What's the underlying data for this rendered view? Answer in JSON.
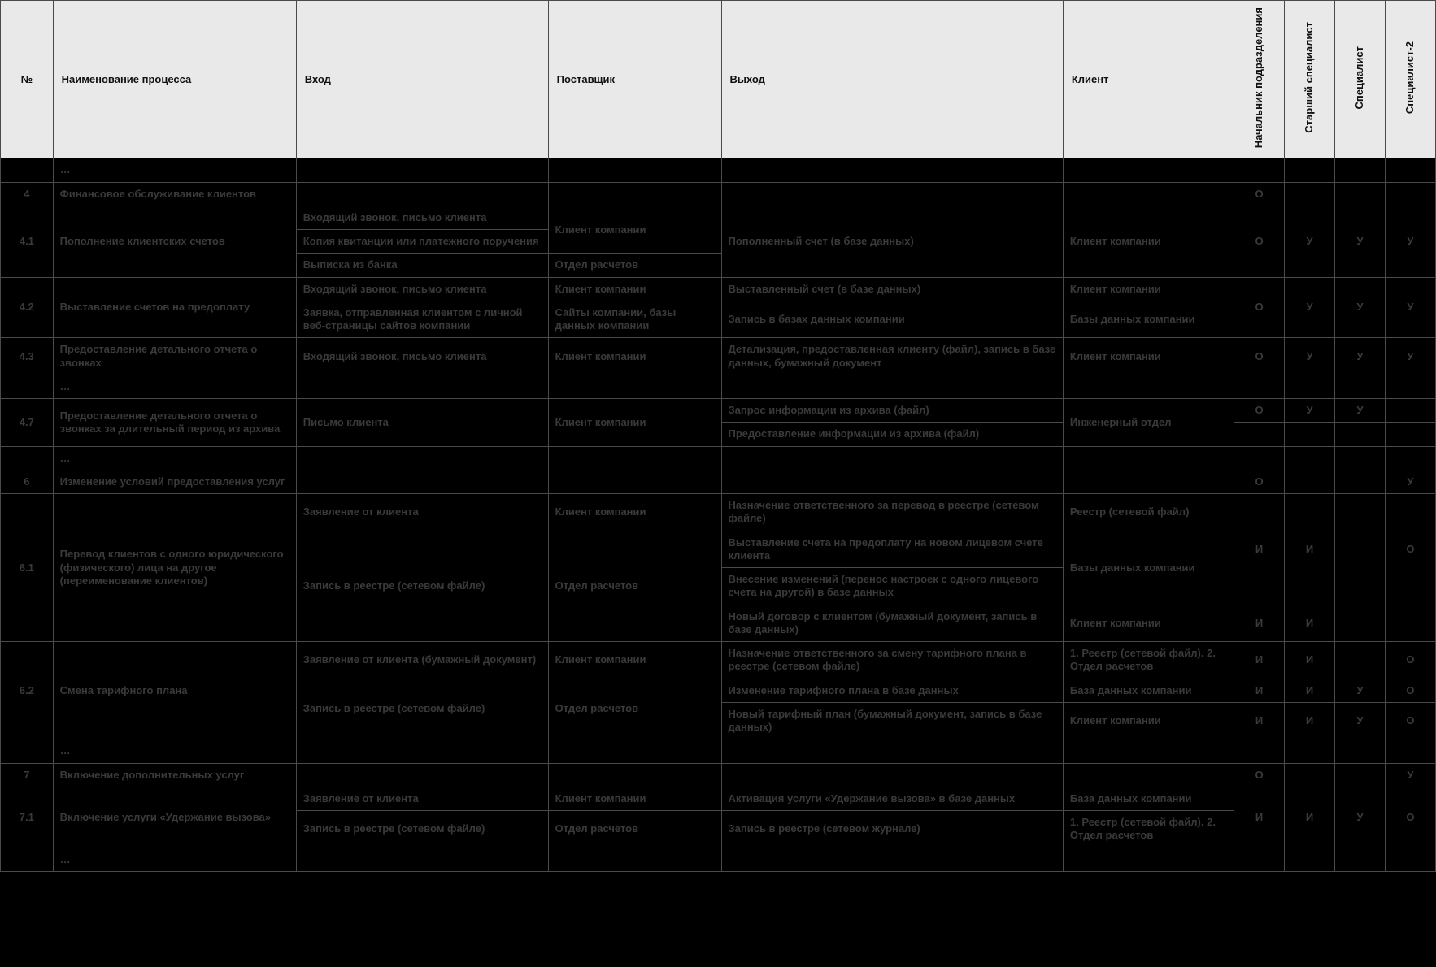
{
  "headers": {
    "num": "№",
    "name": "Наименование процесса",
    "input": "Вход",
    "supplier": "Поставщик",
    "output": "Выход",
    "client": "Клиент",
    "role1": "Начальник подразделения",
    "role2": "Старший специалист",
    "role3": "Специалист",
    "role4": "Специалист-2"
  },
  "ell": "…",
  "r4": {
    "num": "4",
    "name": "Финансовое обслуживание клиентов",
    "r1": "О"
  },
  "r41": {
    "num": "4.1",
    "name": "Пополнение клиентских счетов",
    "in1": "Входящий звонок, письмо клиента",
    "in2": "Копия квитанции или платежного поручения",
    "in3": "Выписка из банка",
    "sup12": "Клиент компании",
    "sup3": "Отдел расчетов",
    "out": "Пополненный счет (в базе данных)",
    "cli": "Клиент компании",
    "r1": "О",
    "r2": "У",
    "r3": "У",
    "r4": "У"
  },
  "r42": {
    "num": "4.2",
    "name": "Выставление счетов на предоплату",
    "in1": "Входящий звонок, письмо клиента",
    "sup1": "Клиент компании",
    "out1": "Выставленный счет (в базе данных)",
    "cli1": "Клиент компании",
    "in2": "Заявка, отправленная клиентом с личной веб-страницы сайтов компании",
    "sup2": "Сайты компании, базы данных компании",
    "out2": "Запись в базах данных компании",
    "cli2": "Базы данных  компании",
    "r1": "О",
    "r2": "У",
    "r3": "У",
    "r4": "У"
  },
  "r43": {
    "num": "4.3",
    "name": "Предоставление детального отчета о звонках",
    "in": "Входящий звонок, письмо клиента",
    "sup": "Клиент компании",
    "out": "Детализация, предоставленная клиенту (файл), запись в базе данных, бумажный документ",
    "cli": "Клиент компании",
    "r1": "О",
    "r2": "У",
    "r3": "У",
    "r4": "У"
  },
  "r47": {
    "num": "4.7",
    "name": "Предоставление детального отчета о звонках за длительный период из архива",
    "in": "Письмо клиента",
    "sup": "Клиент компании",
    "out1": "Запрос информации из архива (файл)",
    "out2": "Предоставление информации из архива (файл)",
    "cli1": "Инженерный отдел",
    "r1": "О",
    "r2": "У",
    "r3": "У"
  },
  "r6": {
    "num": "6",
    "name": "Изменение условий предоставления услуг",
    "r1": "О",
    "r4": "У"
  },
  "r61": {
    "num": "6.1",
    "name": "Перевод клиентов с одного юридического (физического) лица на другое (переименование клиентов)",
    "in1": "Заявление от клиента",
    "sup1": "Клиент компании",
    "out1": "Назначение ответственного за перевод в реестре (сетевом файле)",
    "cli1": "Реестр (сетевой файл)",
    "in234": "Запись в реестре (сетевом файле)",
    "sup234": "Отдел расчетов",
    "out2": "Выставление счета на предоплату на новом лицевом счете клиента",
    "out3": "Внесение изменений (перенос настроек с одного лицевого счета на другой)  в базе данных",
    "cli23": "Базы данных  компании",
    "out4": "Новый договор с клиентом (бумажный документ, запись в базе данных)",
    "cli4": "Клиент компании",
    "r13a": "И",
    "r13b": "И",
    "r13d": "О",
    "r4a": "И",
    "r4b": "И"
  },
  "r62": {
    "num": "6.2",
    "name": "Смена тарифного плана",
    "in1": "Заявление от клиента (бумажный документ)",
    "sup1": "Клиент компании",
    "out1": "Назначение ответственного за смену тарифного плана в реестре (сетевом файле)",
    "cli1": "1. Реестр (сетевой файл). 2. Отдел расчетов",
    "in23": "Запись в реестре (сетевом файле)",
    "sup23": "Отдел расчетов",
    "out2": "Изменение тарифного плана  в базе данных",
    "cli2": "База данных компании",
    "out3": "Новый тарифный план (бумажный документ, запись в базе данных)",
    "cli3": "Клиент компании",
    "rA1": "И",
    "rA2": "И",
    "rA4": "О",
    "rB1": "И",
    "rB2": "И",
    "rB3": "У",
    "rB4": "О",
    "rC1": "И",
    "rC2": "И",
    "rC3": "У",
    "rC4": "О"
  },
  "r7": {
    "num": "7",
    "name": "Включение дополнительных услуг",
    "r1": "О",
    "r4": "У"
  },
  "r71": {
    "num": "7.1",
    "name": "Включение услуги «Удержание вызова»",
    "in1": "Заявление от клиента",
    "sup1": "Клиент компании",
    "out1": "Активация услуги «Удержание вызова» в базе данных",
    "cli1": "База данных компании",
    "in2": "Запись в реестре (сетевом файле)",
    "sup2": "Отдел расчетов",
    "out2": "Запись в реестре (сетевом журнале)",
    "cli2": "1. Реестр (сетевой файл). 2. Отдел расчетов",
    "r1": "И",
    "r2": "И",
    "r3": "У",
    "r4": "О"
  }
}
